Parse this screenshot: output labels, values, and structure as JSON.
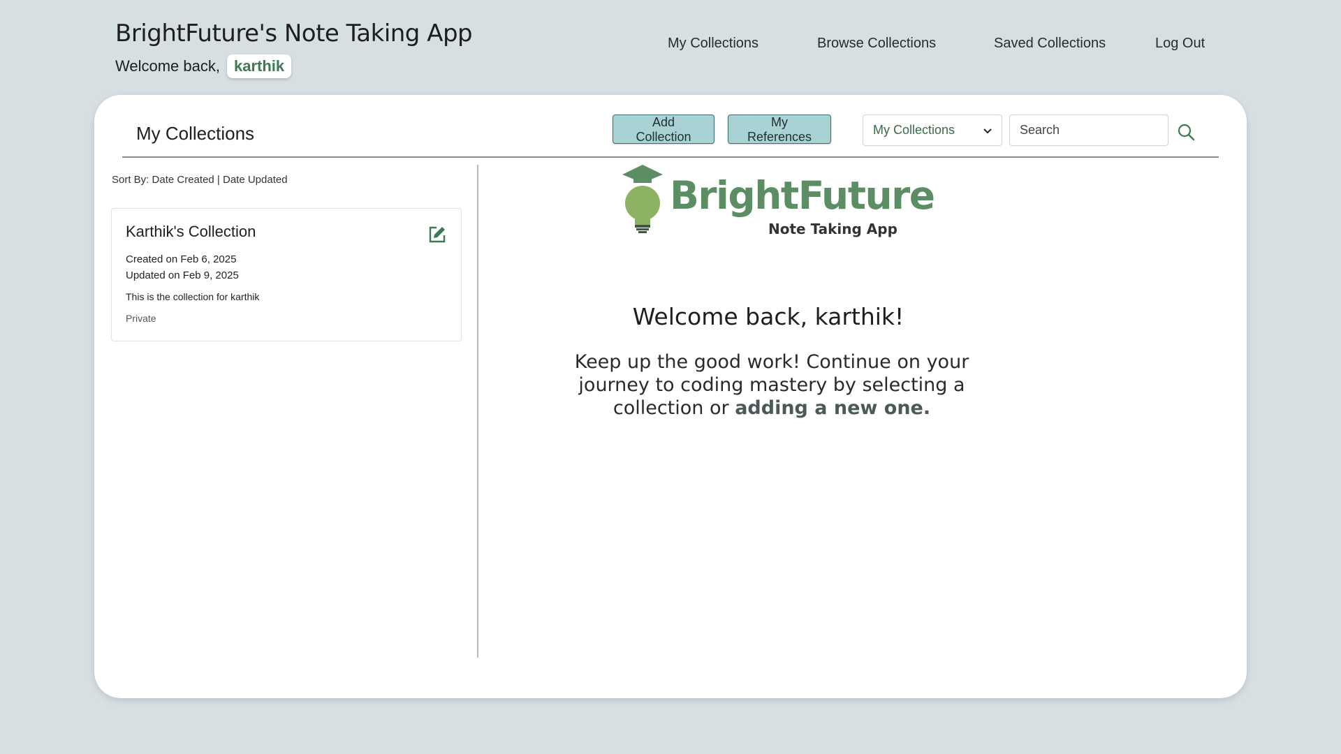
{
  "header": {
    "app_title": "BrightFuture's Note Taking App",
    "welcome_prefix": "Welcome back,",
    "username": "karthik"
  },
  "nav": {
    "items": [
      {
        "label": "My Collections"
      },
      {
        "label": "Browse Collections"
      },
      {
        "label": "Saved Collections"
      },
      {
        "label": "Log Out"
      }
    ]
  },
  "toolbar": {
    "title": "My Collections",
    "add_label": "Add Collection",
    "refs_label": "My References",
    "filter_selected": "My Collections",
    "search_placeholder": "Search"
  },
  "sort": {
    "prefix": "Sort By:",
    "option_created": "Date Created",
    "separator": "|",
    "option_updated": "Date Updated"
  },
  "collections": [
    {
      "title": "Karthik's Collection",
      "created": "Created on Feb 6, 2025",
      "updated": "Updated on Feb 9, 2025",
      "description": "This is the collection for karthik",
      "visibility": "Private"
    }
  ],
  "logo": {
    "name": "BrightFuture",
    "subtitle": "Note Taking App"
  },
  "welcome": {
    "heading": "Welcome back, karthik!",
    "body": "Keep up the good work! Continue on your journey to coding mastery by selecting a collection or",
    "link": "adding a new one."
  },
  "colors": {
    "background": "#d6dfe2",
    "accent_green": "#3c7a52",
    "logo_green": "#5b8f63",
    "button_fill": "#a9d2d4"
  },
  "icons": {
    "search": "search-icon",
    "edit": "edit-icon",
    "dropdown": "chevron-down-icon",
    "logo": "lightbulb-graduation-cap-icon"
  }
}
